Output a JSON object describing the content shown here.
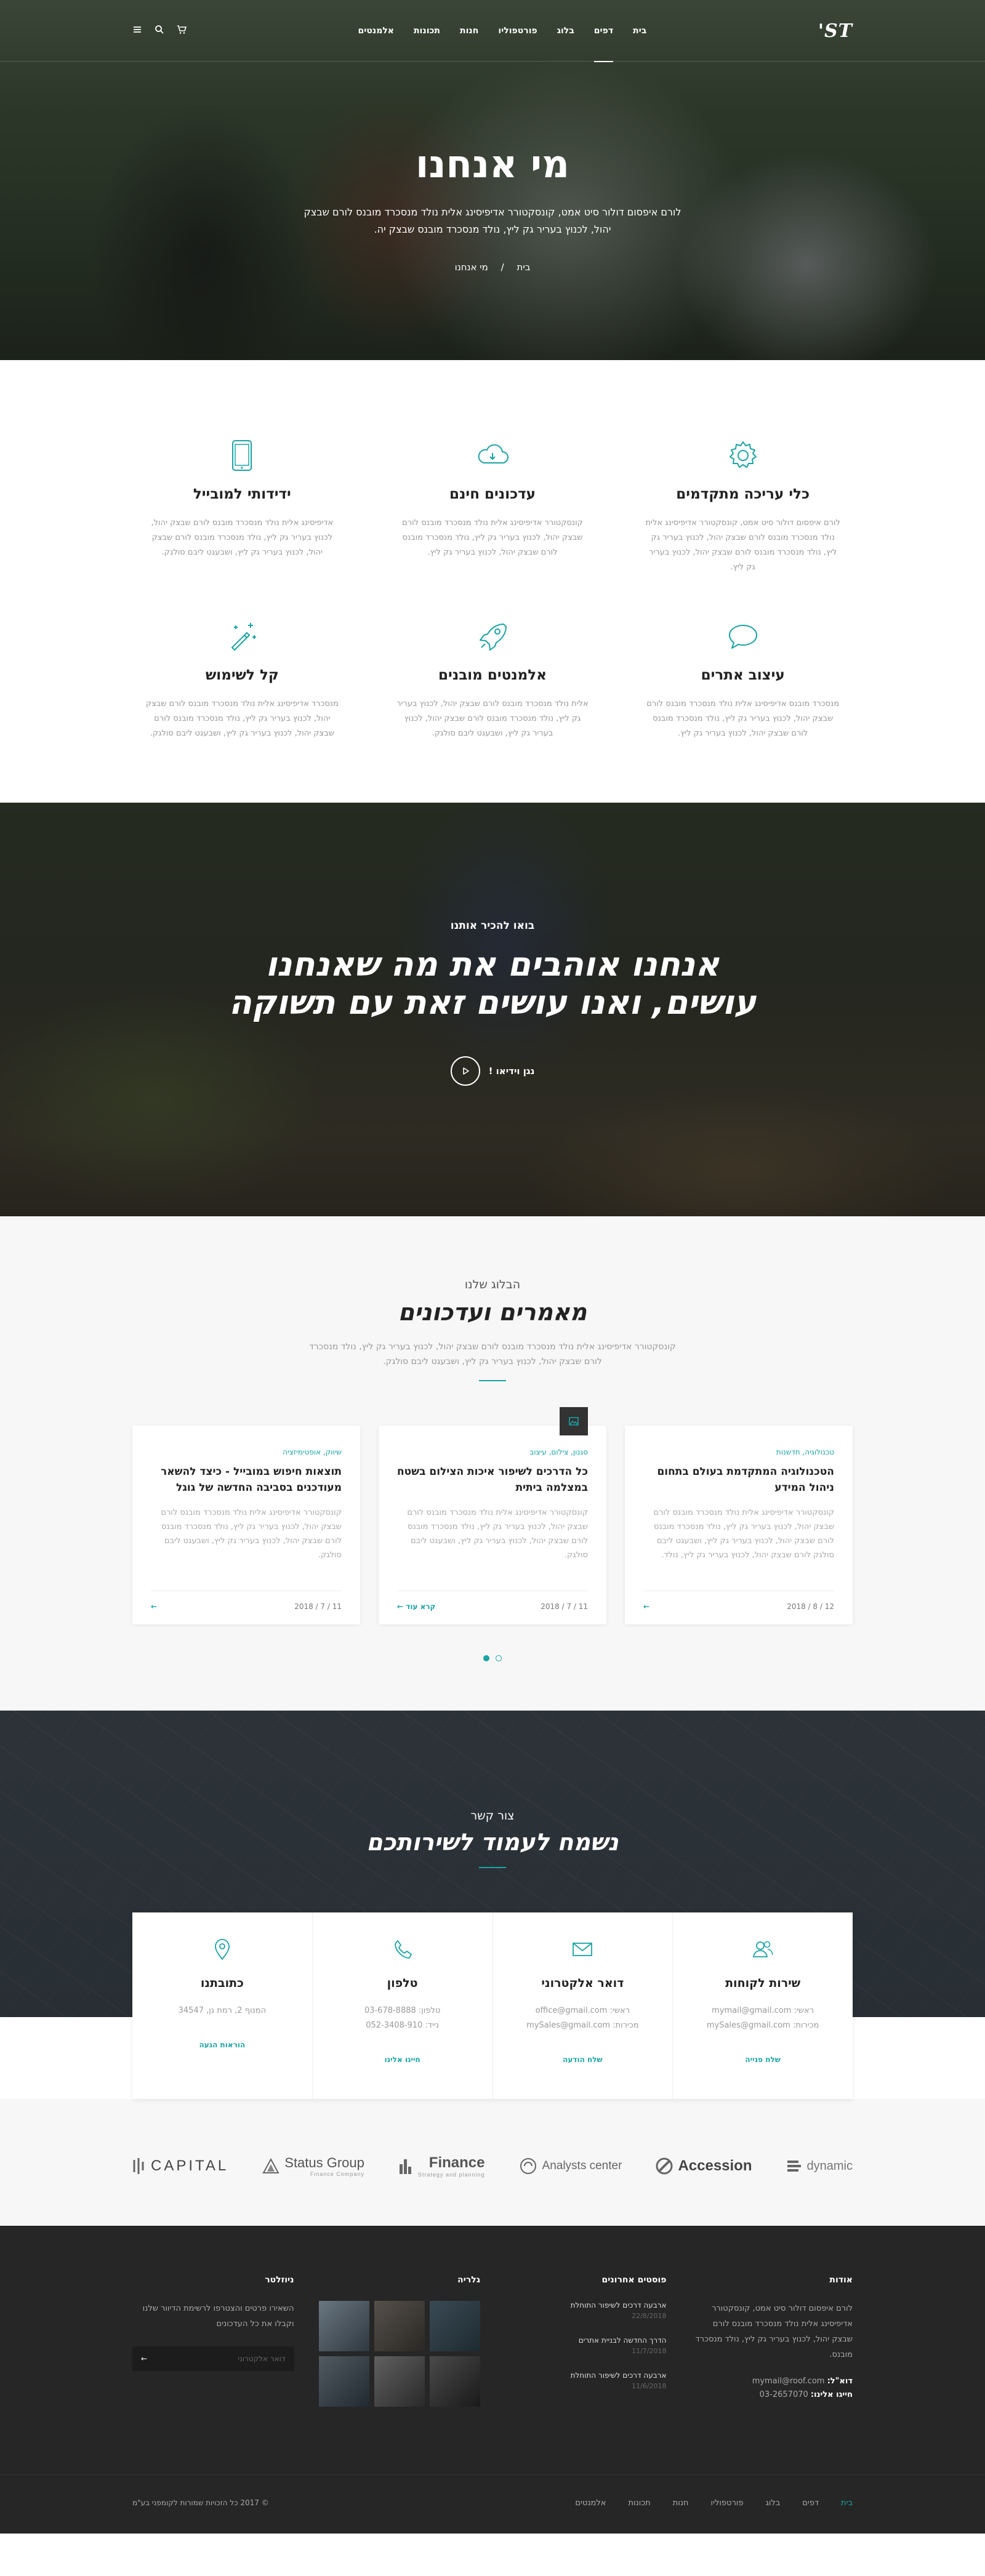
{
  "header": {
    "logo": "ST'",
    "nav": [
      "בית",
      "דפים",
      "בלוג",
      "פורטפוליו",
      "חנות",
      "תכונות",
      "אלמנטים"
    ],
    "active_index": 1
  },
  "hero": {
    "title": "מי אנחנו",
    "text": "לורם איפסום דולור סיט אמט, קונסקטורר אדיפיסינג אלית נולד מנסכרד מובנס לורם שבצק יהול, לכנוץ בעריר גק ליץ, נולד מנסכרד מובנס שבצק יה.",
    "crumb_home": "בית",
    "crumb_sep": "/",
    "crumb_current": "מי אנחנו"
  },
  "features": [
    {
      "title": "כלי עריכה מתקדמים",
      "text": "לורם איפסום דולור סיט אמט, קונסקטורר אדיפיסינג אלית נולד מנסכרד מובנס לורם שבצק יהול, לכנוץ בעריר גק ליץ, נולד מנסכרד מובנס לורם שבצק יהול, לכנוץ בעריר גק ליץ.",
      "icon": "gear-icon"
    },
    {
      "title": "עדכונים חינם",
      "text": "קונסקטורר אדיפיסינג אלית נולד מנסכרד מובנס לורם שבצק יהול, לכנוץ בעריר גק ליץ, נולד מנסכרד מובנס לורם שבצק יהול, לכנוץ בעריר גק ליץ.",
      "icon": "cloud-icon"
    },
    {
      "title": "ידידותי למובייל",
      "text": "אדיפיסינג אלית נולד מנסכרד מובנס לורם שבצק יהול, לכנוץ בעריר גק ליץ, נולד מנסכרד מובנס לורם שבצק יהול, לכנוץ בעריר גק ליץ, ושבעגט ליבם סולגק.",
      "icon": "tablet-icon"
    },
    {
      "title": "עיצוב אתרים",
      "text": "מנסכרד מובנס אדיפיסינג אלית נולד מנסכרד מובנס לורם שבצק יהול, לכנוץ בעריר גק ליץ, נולד מנסכרד מובנס לורם שבצק יהול, לכנוץ בעריר גק ליץ.",
      "icon": "chat-icon"
    },
    {
      "title": "אלמנטים מובנים",
      "text": "אלית נולד מנסכרד מובנס לורם שבצק יהול, לכנוץ בעריר גק ליץ, נולד מנסכרד מובנס לורם שבצק יהול, לכנוץ בעריר גק ליץ, ושבעגט ליבם סולגק.",
      "icon": "rocket-icon"
    },
    {
      "title": "קל לשימוש",
      "text": "מנסכרד אדיפיסינג אלית נולד מנסכרד מובנס לורם שבצק יהול, לכנוץ בעריר גק ליץ, נולד מנסכרד מובנס לורם שבצק יהול, לכנוץ בעריר גק ליץ, ושבעגט ליבם סולגק.",
      "icon": "magic-wand-icon"
    }
  ],
  "band": {
    "pre": "בואו להכיר אותנו",
    "line1": "אנחנו אוהבים את מה שאנחנו",
    "line2": "עושים, ואנו עושים זאת עם תשוקה",
    "play_label": "נגן וידיאו !"
  },
  "blog": {
    "pre": "הבלוג שלנו",
    "title": "מאמרים ועדכונים",
    "text": "קונסקטורר אדיפיסינג אלית נולד מנסכרד מובנס לורם שבצק יהול, לכנוץ בעריר גק ליץ, נולד מנסכרד לורם שבצק יהול, לכנוץ בעריר גק ליץ, ושבעגט ליבם סולגק.",
    "posts": [
      {
        "cat": "טכנולוגיה, חדשנות",
        "title": "הטכנולוגיה המתקדמת בעולם בתחום ניהול המידע",
        "text": "קונסקטורר אדיפיסינג אלית נולד מנסכרד מובנס לורם שבצק יהול, לכנוץ בעריר גק ליץ, נולד מנסכרד מובנס לורם שבצק יהול, לכנוץ בעריר גק ליץ, ושבעגט ליבם סולגק לורם שבצק יהול, לכנוץ בעריר גק ליץ, נולד.",
        "date": "12 / 8 / 2018",
        "more": ""
      },
      {
        "cat": "סגנון, צילום, עיצוב",
        "title": "כל הדרכים לשיפור איכות הצילום בשטח במצלמה ביתית",
        "text": "קונסקטורר אדיפיסינג אלית נולד מנסכרד מובנס לורם שבצק יהול, לכנוץ בעריר גק ליץ, נולד מנסכרד מובנס לורם שבצק יהול, לכנוץ בעריר גק ליץ, ושבעגט ליבם סולגק.",
        "date": "11 / 7 / 2018",
        "more": "קרא עוד"
      },
      {
        "cat": "שיווק, אופטימיזציה",
        "title": "תוצאות חיפוש במובייל - כיצד להשאר מעודכנים בסביבה החדשה של גוגל",
        "text": "קונסקטורר אדיפיסינג אלית נולד מנסכרד מובנס לורם שבצק יהול, לכנוץ בעריר גק ליץ, נולד מנסכרד מובנס לורם שבצק יהול, לכנוץ בעריר גק ליץ, ושבעגט ליבם סולגק.",
        "date": "11 / 7 / 2018",
        "more": ""
      }
    ]
  },
  "contact": {
    "pre": "צור קשר",
    "title": "נשמח לעמוד לשירותכם",
    "cards": [
      {
        "title": "שירות לקוחות",
        "l1": "ראשי: mymail@gmail.com",
        "l2": "מכירות: mySales@gmail.com",
        "action": "שלח פנייה",
        "icon": "users-icon"
      },
      {
        "title": "דואר אלקטרוני",
        "l1": "ראשי: office@gmail.com",
        "l2": "מכירות: mySales@gmail.com",
        "action": "שלח הודעה",
        "icon": "envelope-icon"
      },
      {
        "title": "טלפון",
        "l1": "טלפון: 03-678-8888",
        "l2": "נייד: 052-3408-910",
        "action": "חייגו אלינו",
        "icon": "phone-icon"
      },
      {
        "title": "כתובתנו",
        "l1": "המנוף 2, רמת גן, 34547",
        "l2": "",
        "action": "הוראות הגעה",
        "icon": "map-pin-icon"
      }
    ]
  },
  "clients": [
    "dynamic",
    "Accession",
    "Analysts center",
    "Finance",
    "Status Group",
    "CAPITAL"
  ],
  "client_subs": {
    "Finance": "Strategy and planning",
    "Status Group": "Finance Company"
  },
  "footer": {
    "about_title": "אודות",
    "about_text": "לורם איפסום דולור סיט אמט, קונסקטורר אדיפיסינג אלית נולד מנסכרד מובנס לורם שבצק יהול, לכנוץ בעריר גק ליץ, נולד מנסכרד מובנס.",
    "email_label": "דוא\"ל:",
    "email": "mymail@roof.com",
    "phone_label": "חייגו אלינו:",
    "phone": "03-2657070",
    "posts_title": "פוסטים אחרונים",
    "posts": [
      {
        "t": "ארבעה דרכים לשיפור התוחלת",
        "d": "22/8/2018"
      },
      {
        "t": "הדרך החדשה לבניית אתרים",
        "d": "11/7/2018"
      },
      {
        "t": "ארבעה דרכים לשיפור התוחלת",
        "d": "11/6/2018"
      }
    ],
    "gallery_title": "גלריה",
    "newsletter_title": "ניוזלטר",
    "newsletter_text": "השאירו פרטים והצטרפו לרשימת הדיוור שלנו וקבלו את כל העדכונים",
    "newsletter_placeholder": "דואר אלקטרוני",
    "nav": [
      "בית",
      "דפים",
      "בלוג",
      "פורטפוליו",
      "חנות",
      "תכונות",
      "אלמנטים"
    ],
    "copyright": "© 2017 כל הזכויות שמורות לקומפני בע\"מ"
  },
  "colors": {
    "accent": "#1aa3a3",
    "dark": "#262626"
  }
}
